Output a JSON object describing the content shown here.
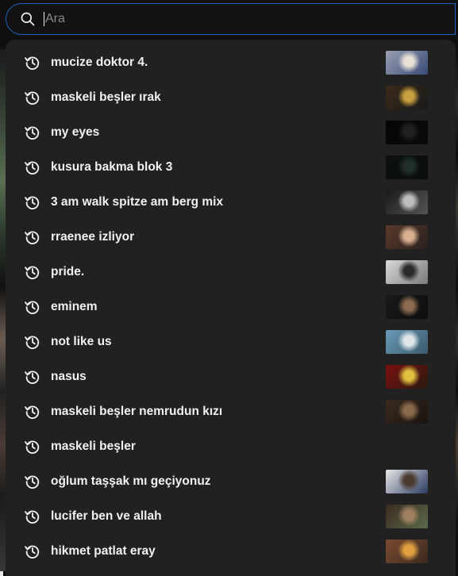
{
  "search": {
    "placeholder": "Ara",
    "value": ""
  },
  "suggestions": [
    {
      "text": "mucize doktor 4.",
      "icon": "history-icon",
      "thumbnail": {
        "colors": [
          "#9aa0b0",
          "#e6e0d6",
          "#3a4a7a"
        ]
      }
    },
    {
      "text": "maskeli beşler ırak",
      "icon": "history-icon",
      "thumbnail": {
        "colors": [
          "#3a2a1a",
          "#c8a040",
          "#1a1a1a"
        ]
      }
    },
    {
      "text": "my eyes",
      "icon": "history-icon",
      "thumbnail": {
        "colors": [
          "#050505",
          "#202020",
          "#0a0a0a"
        ]
      }
    },
    {
      "text": "kusura bakma blok 3",
      "icon": "history-icon",
      "thumbnail": {
        "colors": [
          "#0c110e",
          "#22302a",
          "#0a0d0b"
        ]
      }
    },
    {
      "text": "3 am walk spitze am berg mix",
      "icon": "history-icon",
      "thumbnail": {
        "colors": [
          "#1a1a1a",
          "#bdbdbd",
          "#555555"
        ]
      }
    },
    {
      "text": "rraenee izliyor",
      "icon": "history-icon",
      "thumbnail": {
        "colors": [
          "#5a3a2a",
          "#d8b090",
          "#2a2020"
        ]
      }
    },
    {
      "text": "pride.",
      "icon": "history-icon",
      "thumbnail": {
        "colors": [
          "#d9d9d9",
          "#2a2a2a",
          "#7a7a7a"
        ]
      }
    },
    {
      "text": "eminem",
      "icon": "history-icon",
      "thumbnail": {
        "colors": [
          "#1a1a1a",
          "#8a6a50",
          "#0d0d0d"
        ]
      }
    },
    {
      "text": "not like us",
      "icon": "history-icon",
      "thumbnail": {
        "colors": [
          "#6a9ab8",
          "#e0e6ea",
          "#3a5a6a"
        ]
      }
    },
    {
      "text": "nasus",
      "icon": "history-icon",
      "thumbnail": {
        "colors": [
          "#7a1010",
          "#e0c040",
          "#2a1a10"
        ]
      }
    },
    {
      "text": "maskeli beşler nemrudun kızı",
      "icon": "history-icon",
      "thumbnail": {
        "colors": [
          "#3a2a20",
          "#8a6a4a",
          "#1a1410"
        ]
      }
    },
    {
      "text": "maskeli beşler",
      "icon": "history-icon",
      "thumbnail": null
    },
    {
      "text": "oğlum taşşak mı geçiyonuz",
      "icon": "history-icon",
      "thumbnail": {
        "colors": [
          "#e8e8e8",
          "#4a3a30",
          "#2a3a60"
        ]
      }
    },
    {
      "text": "lucifer ben ve allah",
      "icon": "history-icon",
      "thumbnail": {
        "colors": [
          "#3a2a20",
          "#a08060",
          "#5a6a4a"
        ]
      }
    },
    {
      "text": "hikmet patlat eray",
      "icon": "history-icon",
      "thumbnail": {
        "colors": [
          "#7a4a30",
          "#e0a040",
          "#3a2a20"
        ]
      }
    }
  ],
  "colors": {
    "dropdown_bg": "#212121",
    "focus_border": "#1c62b9",
    "text": "#f1f1f1",
    "placeholder": "#888888"
  }
}
